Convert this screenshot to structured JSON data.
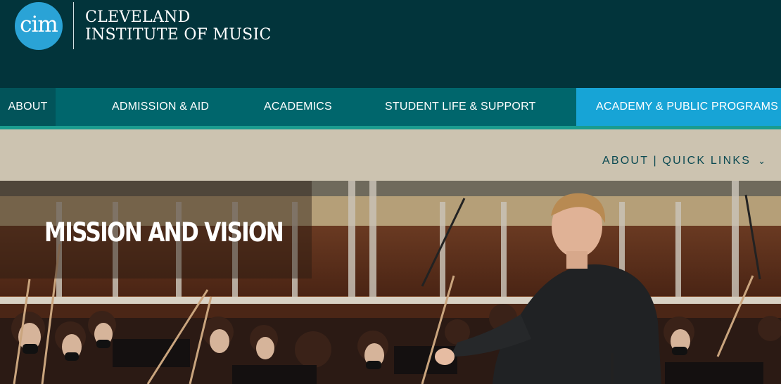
{
  "header": {
    "logo_mark": "cim",
    "logo_line1": "CLEVELAND",
    "logo_line2": "INSTITUTE OF MUSIC"
  },
  "nav": {
    "items": [
      {
        "label": "ABOUT",
        "active": true
      },
      {
        "label": "ADMISSION & AID"
      },
      {
        "label": "ACADEMICS"
      },
      {
        "label": "STUDENT LIFE & SUPPORT"
      },
      {
        "label": "ACADEMY & PUBLIC PROGRAMS",
        "highlight": true
      }
    ]
  },
  "quick_links": {
    "label": "ABOUT | QUICK LINKS",
    "icon": "chevron-down-icon"
  },
  "hero": {
    "title": "MISSION AND VISION",
    "image_alt_icon": "orchestra-photo"
  },
  "colors": {
    "header_bg": "#02343b",
    "nav_bg": "#00666c",
    "nav_highlight": "#17a4d6",
    "band_bg": "#ccc3b0",
    "accent": "#1cab97"
  }
}
